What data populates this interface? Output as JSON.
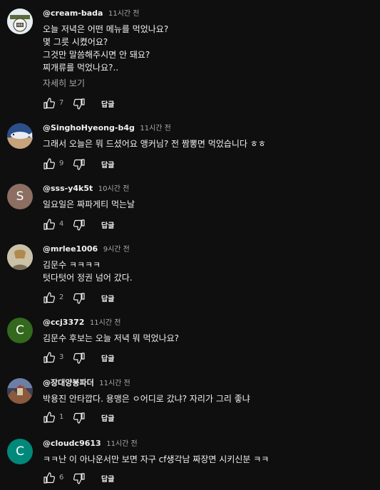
{
  "comments": [
    {
      "handle": "@cream-bada",
      "time": "11시간 전",
      "lines": [
        "오늘 저녁은 어떤 메뉴를 먹었나요?",
        "몇 그릇 시켰어요?",
        "그것만 말씀해주시면 안 돼요?",
        "찌개류를 먹었나요?.."
      ],
      "more": "자세히 보기",
      "likes": "7",
      "reply": "답글",
      "avatar": {
        "type": "image",
        "bg": "#e6eef1",
        "icon": "cartoon-face-avatar"
      }
    },
    {
      "handle": "@SinghoHyeong-b4g",
      "time": "11시간 전",
      "lines": [
        "그래서 오늘은 뭐 드셨어요 앵커님? 전 짬뽕면 먹었습니다 ㅎㅎ"
      ],
      "likes": "9",
      "reply": "답글",
      "avatar": {
        "type": "image",
        "bg": "#2a4f8a",
        "icon": "fish-avatar"
      }
    },
    {
      "handle": "@sss-y4k5t",
      "time": "10시간 전",
      "lines": [
        "일요일은 짜파게티 먹는날"
      ],
      "likes": "4",
      "reply": "답글",
      "avatar": {
        "type": "letter",
        "letter": "S",
        "bg": "#8d6e63"
      }
    },
    {
      "handle": "@mrlee1006",
      "time": "9시간 전",
      "lines": [
        "김문수 ㅋㅋㅋㅋ",
        "텃다텃어 정권 넘어 갔다."
      ],
      "likes": "2",
      "reply": "답글",
      "avatar": {
        "type": "image",
        "bg": "#c9c1a8",
        "icon": "photo-avatar"
      }
    },
    {
      "handle": "@ccj3372",
      "time": "11시간 전",
      "lines": [
        "김문수 후보는 오늘 저녁 뭐 먹었나요?"
      ],
      "likes": "3",
      "reply": "답글",
      "avatar": {
        "type": "letter",
        "letter": "C",
        "bg": "#33691e"
      }
    },
    {
      "handle": "@장대양봉파더",
      "time": "11시간 전",
      "lines": [
        "박용진 안타깝다. 용맹은 ㅇ어디로 갔냐? 자리가 그리 좋냐"
      ],
      "likes": "1",
      "reply": "답글",
      "avatar": {
        "type": "image",
        "bg": "#3b3f58",
        "icon": "landscape-avatar"
      }
    },
    {
      "handle": "@cloudc9613",
      "time": "11시간 전",
      "lines": [
        "ㅋㅋ난 이 아나운서만 보면  자구 cf생각남 짜장면 시키신분 ㅋㅋ"
      ],
      "likes": "6",
      "reply": "답글",
      "avatar": {
        "type": "letter",
        "letter": "C",
        "bg": "#00897b"
      }
    }
  ]
}
